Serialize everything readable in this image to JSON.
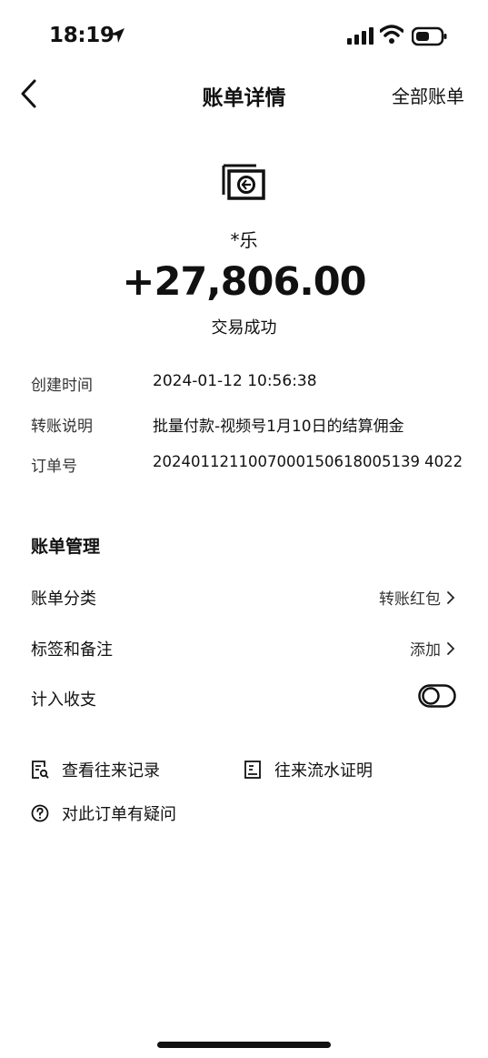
{
  "status_bar": {
    "time": "18:19"
  },
  "nav": {
    "title": "账单详情",
    "right_link": "全部账单"
  },
  "header": {
    "payee": "*乐",
    "amount": "+27,806.00",
    "status": "交易成功"
  },
  "details": [
    {
      "label": "创建时间",
      "value": "2024-01-12 10:56:38"
    },
    {
      "label": "转账说明",
      "value": "批量付款-视频号1月10日的结算佣金"
    },
    {
      "label": "订单号",
      "value": "2024011211007000150618005139 4022"
    }
  ],
  "management": {
    "title": "账单管理",
    "category_label": "账单分类",
    "category_value": "转账红包",
    "tags_label": "标签和备注",
    "tags_value": "添加",
    "count_label": "计入收支"
  },
  "links": {
    "records": "查看往来记录",
    "proof": "往来流水证明",
    "question": "对此订单有疑问"
  },
  "icons": {
    "back": "chevron-left-icon",
    "merchant": "bill-icon",
    "chevron": "chevron-right-icon",
    "records": "document-search-icon",
    "proof": "document-icon",
    "question": "question-circle-icon"
  }
}
